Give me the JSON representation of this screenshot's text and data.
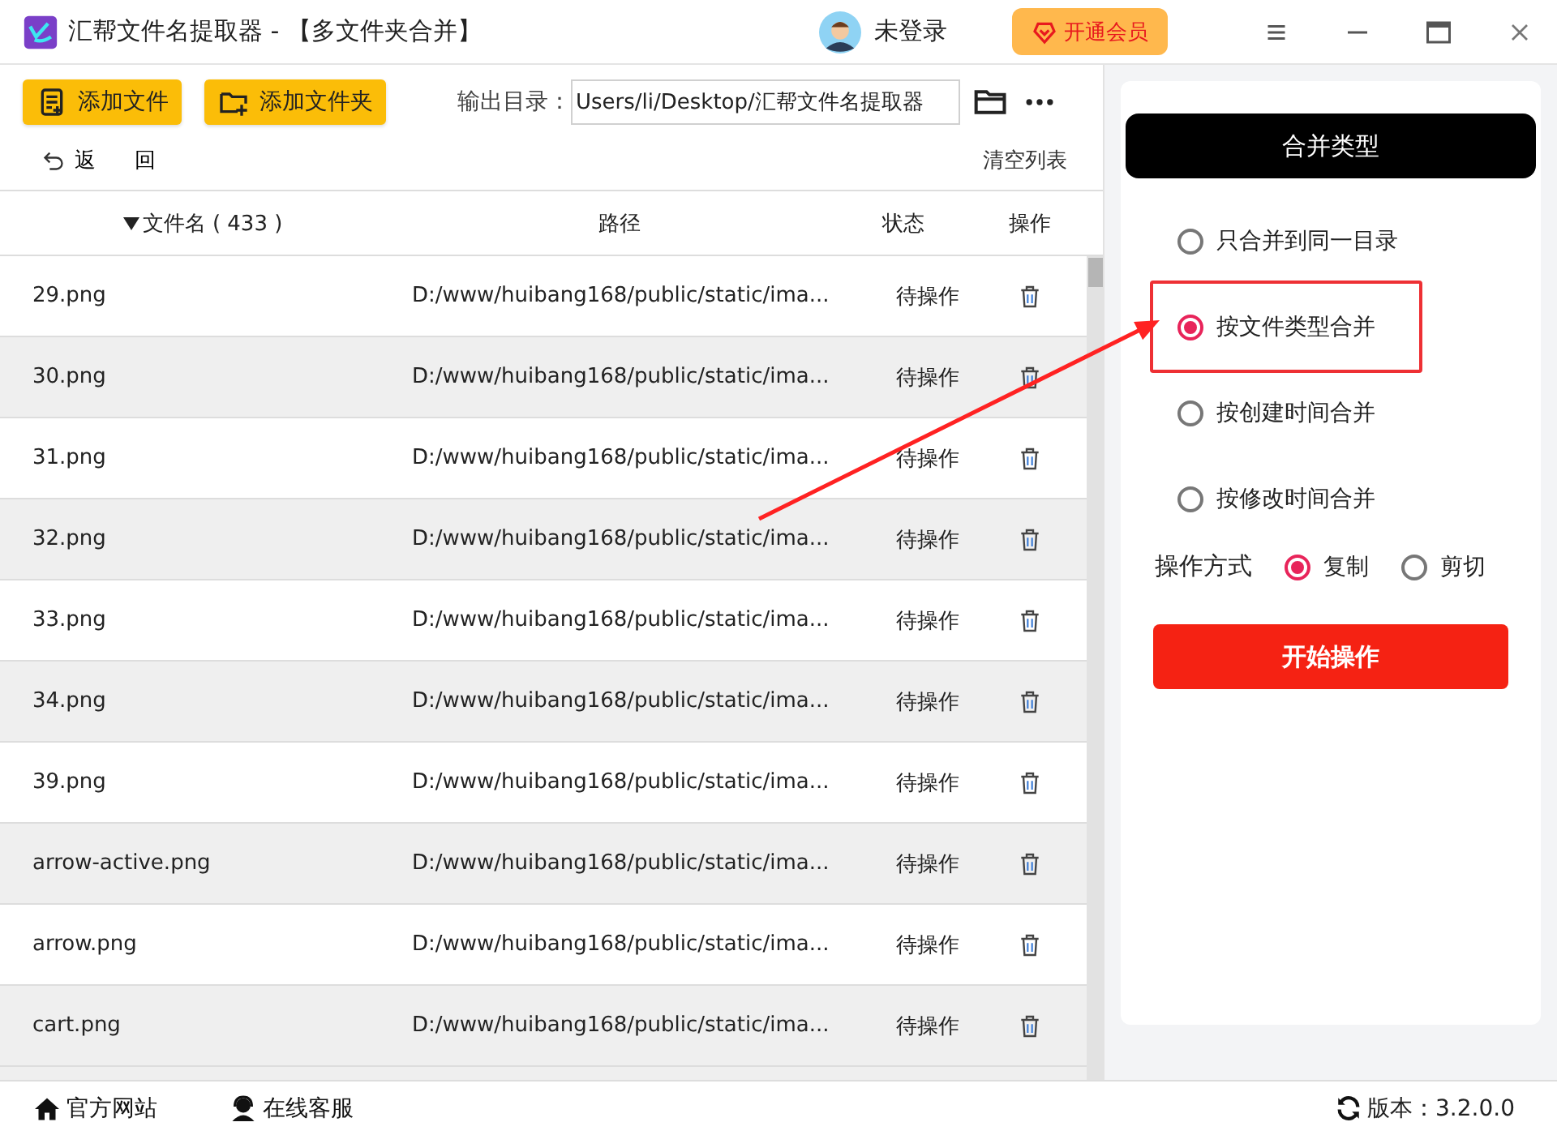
{
  "window": {
    "title": "汇帮文件名提取器 - 【多文件夹合并】",
    "user": "未登录",
    "vip_button": "开通会员"
  },
  "toolbar": {
    "buttons": [
      "添加文件",
      "添加文件夹"
    ],
    "output_label": "输出目录：",
    "output_value": "Users/li/Desktop/汇帮文件名提取器"
  },
  "actions": {
    "back": "返 回",
    "clear": "清空列表"
  },
  "table": {
    "columns": [
      "文件名 ( 433 )",
      "路径",
      "状态",
      "操作"
    ],
    "rows": [
      {
        "name": "29.png",
        "path": "D:/www/huibang168/public/static/ima...",
        "status": "待操作"
      },
      {
        "name": "30.png",
        "path": "D:/www/huibang168/public/static/ima...",
        "status": "待操作"
      },
      {
        "name": "31.png",
        "path": "D:/www/huibang168/public/static/ima...",
        "status": "待操作"
      },
      {
        "name": "32.png",
        "path": "D:/www/huibang168/public/static/ima...",
        "status": "待操作"
      },
      {
        "name": "33.png",
        "path": "D:/www/huibang168/public/static/ima...",
        "status": "待操作"
      },
      {
        "name": "34.png",
        "path": "D:/www/huibang168/public/static/ima...",
        "status": "待操作"
      },
      {
        "name": "39.png",
        "path": "D:/www/huibang168/public/static/ima...",
        "status": "待操作"
      },
      {
        "name": "arrow-active.png",
        "path": "D:/www/huibang168/public/static/ima...",
        "status": "待操作"
      },
      {
        "name": "arrow.png",
        "path": "D:/www/huibang168/public/static/ima...",
        "status": "待操作"
      },
      {
        "name": "cart.png",
        "path": "D:/www/huibang168/public/static/ima...",
        "status": "待操作"
      }
    ]
  },
  "merge_panel": {
    "title": "合并类型",
    "options": [
      {
        "label": "只合并到同一目录",
        "selected": false,
        "highlighted": false
      },
      {
        "label": "按文件类型合并",
        "selected": true,
        "highlighted": true
      },
      {
        "label": "按创建时间合并",
        "selected": false,
        "highlighted": false
      },
      {
        "label": "按修改时间合并",
        "selected": false,
        "highlighted": false
      }
    ],
    "mode_label": "操作方式",
    "modes": [
      {
        "label": "复制",
        "selected": true
      },
      {
        "label": "剪切",
        "selected": false
      }
    ],
    "start_button": "开始操作"
  },
  "footer": {
    "links": [
      "官方网站",
      "在线客服"
    ],
    "version": "版本：3.2.0.0"
  }
}
